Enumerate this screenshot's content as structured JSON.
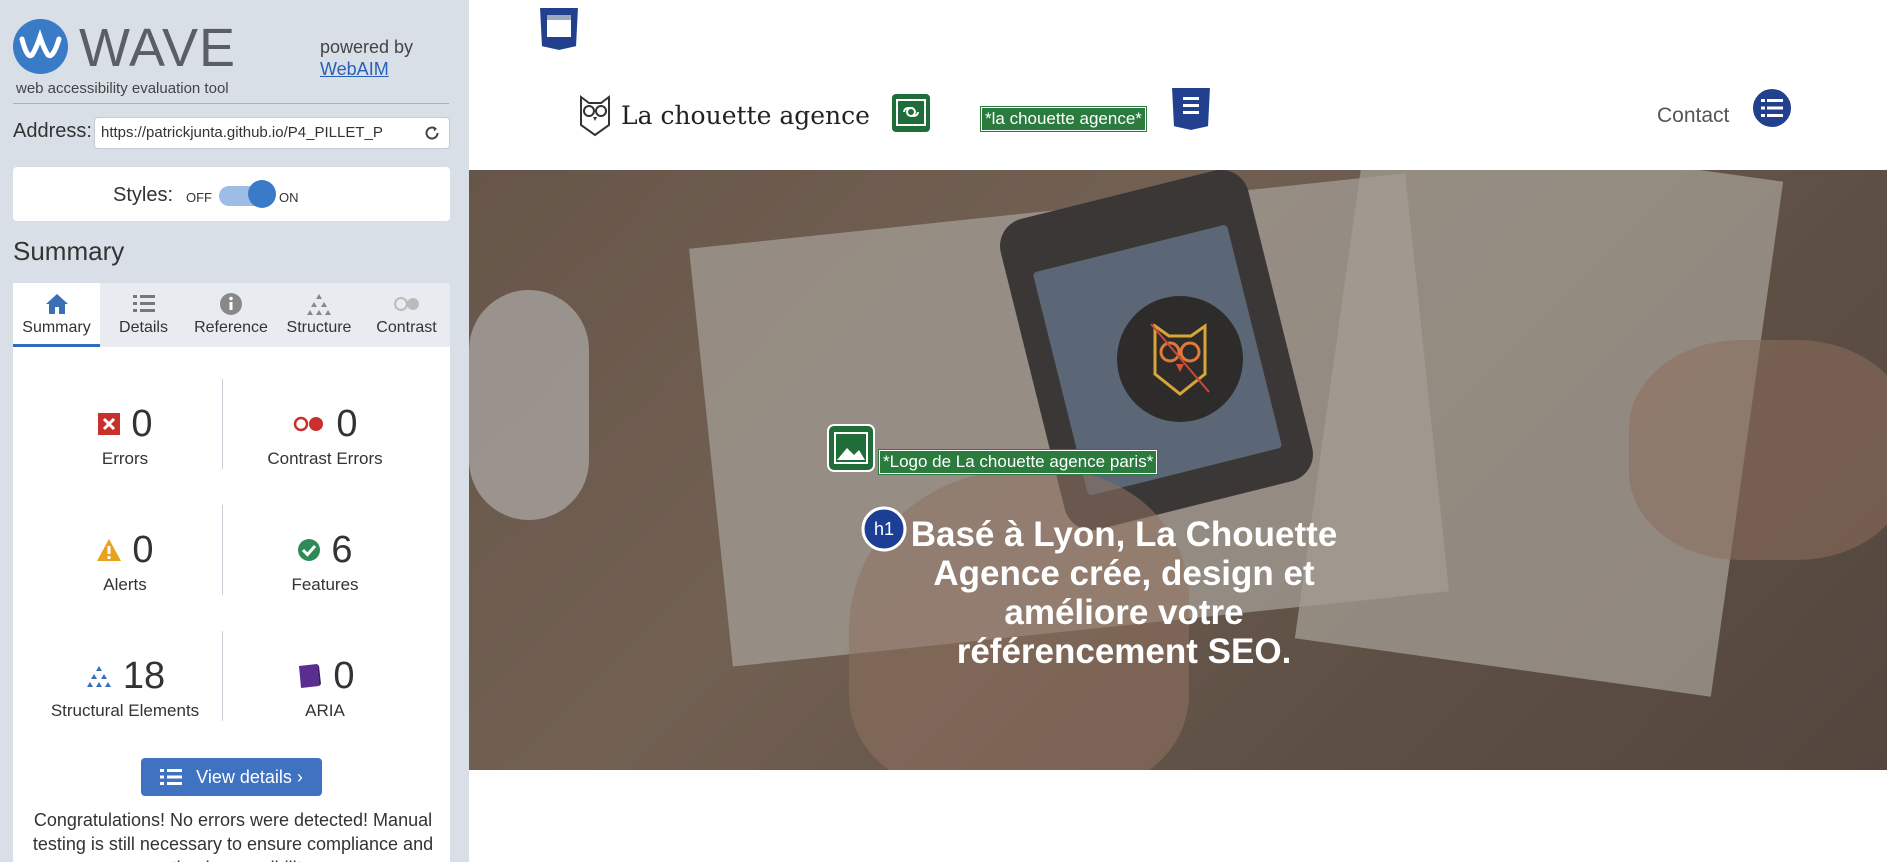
{
  "wave": {
    "title": "WAVE",
    "tagline": "web accessibility evaluation tool",
    "powered_by": "powered by",
    "powered_link": "WebAIM",
    "address_label": "Address:",
    "address_value": "https://patrickjunta.github.io/P4_PILLET_P",
    "styles_label": "Styles:",
    "styles_off": "OFF",
    "styles_on": "ON",
    "summary_heading": "Summary",
    "tabs": [
      {
        "label": "Summary",
        "icon": "home-icon",
        "active": true
      },
      {
        "label": "Details",
        "icon": "list-icon"
      },
      {
        "label": "Reference",
        "icon": "info-icon"
      },
      {
        "label": "Structure",
        "icon": "structure-icon"
      },
      {
        "label": "Contrast",
        "icon": "contrast-icon"
      }
    ],
    "stats": {
      "errors": {
        "count": "0",
        "label": "Errors"
      },
      "contrast_errors": {
        "count": "0",
        "label": "Contrast Errors"
      },
      "alerts": {
        "count": "0",
        "label": "Alerts"
      },
      "features": {
        "count": "6",
        "label": "Features"
      },
      "structural": {
        "count": "18",
        "label": "Structural Elements"
      },
      "aria": {
        "count": "0",
        "label": "ARIA"
      }
    },
    "view_details": "View details ›",
    "congrats": "Congratulations! No errors were detected! Manual testing is still necessary to ensure compliance and optimal accessibility."
  },
  "site": {
    "logo_text": "La chouette agence",
    "logo_alt": "*la chouette agence*",
    "contact": "Contact",
    "hero_logo_alt": "*Logo de La chouette agence paris*",
    "h1_badge": "h1",
    "hero_title": "Basé à Lyon, La Chouette Agence crée, design et améliore votre référencement SEO."
  },
  "colors": {
    "wave_blue": "#3a7bc8",
    "error_red": "#c9302c",
    "alert_orange": "#e8a21b",
    "feature_green": "#2e8b57",
    "aria_purple": "#5a2d91",
    "alt_green": "#2b7b3e"
  }
}
